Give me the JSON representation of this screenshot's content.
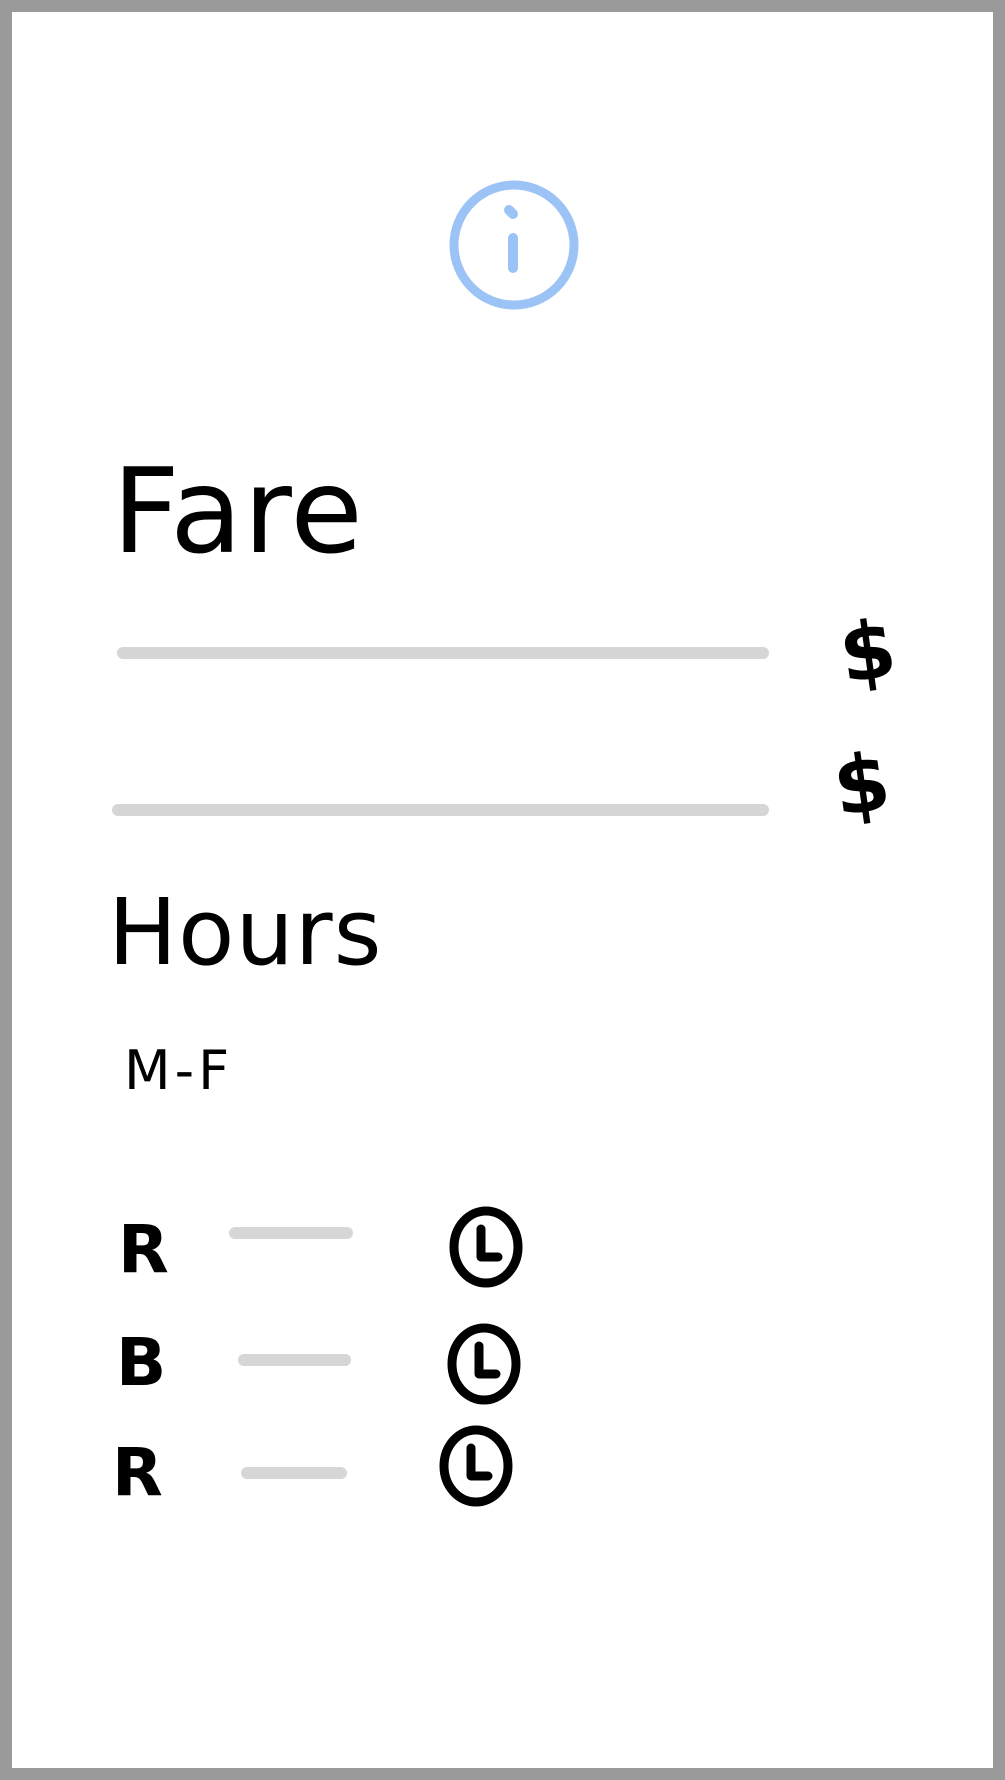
{
  "screen": {
    "info_icon": "info-circle-icon",
    "accent_color": "#9cc3f5",
    "line_color": "#d6d6d6"
  },
  "fare": {
    "title": "Fare",
    "currency_symbol_1": "$",
    "currency_symbol_2": "$"
  },
  "hours": {
    "title": "Hours",
    "days": "M-F",
    "rows": [
      {
        "letter": "R",
        "icon": "clock-icon"
      },
      {
        "letter": "B",
        "icon": "clock-icon"
      },
      {
        "letter": "R",
        "icon": "clock-icon"
      }
    ]
  }
}
